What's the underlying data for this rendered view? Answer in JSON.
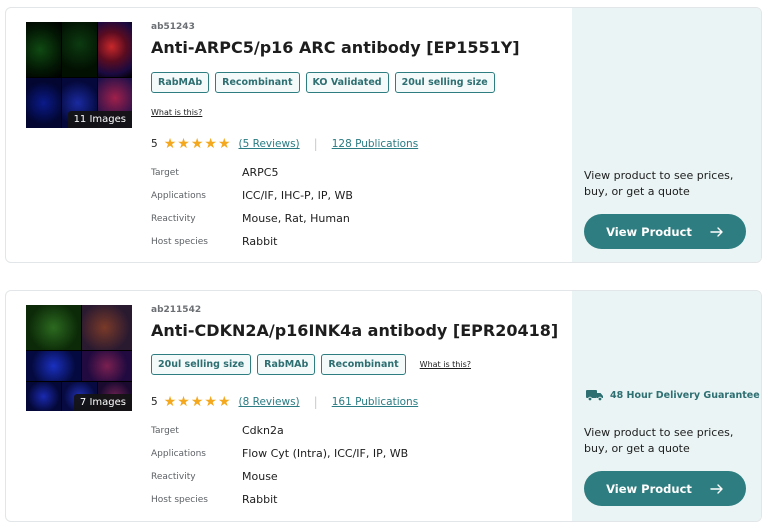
{
  "products": [
    {
      "code": "ab51243",
      "title": "Anti-ARPC5/p16 ARC antibody [EP1551Y]",
      "image_count": "11 Images",
      "tags": [
        "RabMAb",
        "Recombinant",
        "KO Validated",
        "20ul selling size"
      ],
      "what_is_this": "What is this?",
      "rating": "5",
      "reviews": "(5 Reviews)",
      "publications": "128 Publications",
      "specs": [
        {
          "label": "Target",
          "value": "ARPC5"
        },
        {
          "label": "Applications",
          "value": "ICC/IF, IHC-P, IP, WB"
        },
        {
          "label": "Reactivity",
          "value": "Mouse, Rat, Human"
        },
        {
          "label": "Host species",
          "value": "Rabbit"
        }
      ],
      "cta_text": "View product to see prices, buy, or get a quote",
      "button_label": "View Product"
    },
    {
      "code": "ab211542",
      "title": "Anti-CDKN2A/p16INK4a antibody [EPR20418]",
      "image_count": "7 Images",
      "tags": [
        "20ul selling size",
        "RabMAb",
        "Recombinant"
      ],
      "what_is_this": "What is this?",
      "rating": "5",
      "reviews": "(8 Reviews)",
      "publications": "161 Publications",
      "specs": [
        {
          "label": "Target",
          "value": "Cdkn2a"
        },
        {
          "label": "Applications",
          "value": "Flow Cyt (Intra), ICC/IF, IP, WB"
        },
        {
          "label": "Reactivity",
          "value": "Mouse"
        },
        {
          "label": "Host species",
          "value": "Rabbit"
        }
      ],
      "delivery": "48 Hour Delivery Guarantee",
      "cta_text": "View product to see prices, buy, or get a quote",
      "button_label": "View Product"
    }
  ],
  "colors": {
    "accent": "#2e7d80",
    "star": "#f4a81d",
    "side_panel": "#eaf4f4"
  }
}
